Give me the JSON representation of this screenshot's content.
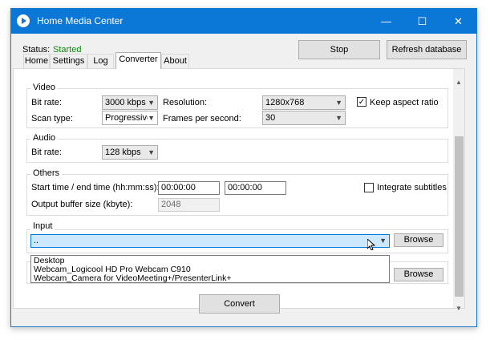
{
  "window": {
    "title": "Home Media Center",
    "min": "—",
    "max": "☐",
    "close": "✕"
  },
  "status": {
    "label": "Status:",
    "value": "Started"
  },
  "buttons": {
    "stop": "Stop",
    "refresh": "Refresh database",
    "convert": "Convert",
    "browse": "Browse"
  },
  "tabs": [
    "Home",
    "Settings",
    "Log",
    "Converter",
    "About"
  ],
  "video": {
    "title": "Video",
    "bitrate_label": "Bit rate:",
    "bitrate_value": "3000 kbps",
    "resolution_label": "Resolution:",
    "resolution_value": "1280x768",
    "keep_aspect_label": "Keep aspect ratio",
    "scantype_label": "Scan type:",
    "scantype_value": "Progressive",
    "fps_label": "Frames per second:",
    "fps_value": "30"
  },
  "audio": {
    "title": "Audio",
    "bitrate_label": "Bit rate:",
    "bitrate_value": "128 kbps"
  },
  "others": {
    "title": "Others",
    "time_label": "Start time / end time (hh:mm:ss):",
    "start_value": "00:00:00",
    "end_value": "00:00:00",
    "integrate_label": "Integrate subtitles",
    "buffer_label": "Output buffer size (kbyte):",
    "buffer_value": "2048"
  },
  "input": {
    "title": "Input",
    "selected": "..",
    "options": [
      "Desktop",
      "Webcam_Logicool HD Pro Webcam C910",
      "Webcam_Camera for VideoMeeting+/PresenterLink+"
    ]
  },
  "colors": {
    "accent": "#0b78d7",
    "status_green": "#0a8a0a",
    "selection": "#cce8ff"
  }
}
